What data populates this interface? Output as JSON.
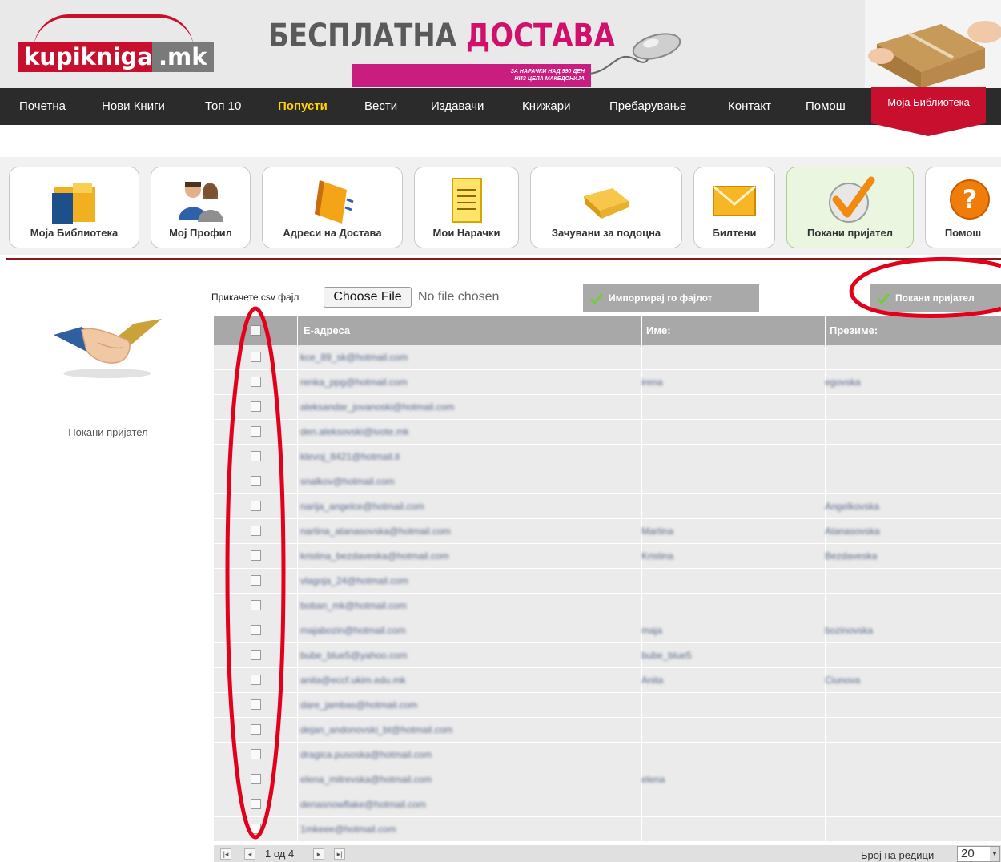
{
  "brand": {
    "logo_left": "kupikniga",
    "logo_right": ".mk"
  },
  "promo": {
    "title_part1": "БЕСПЛАТНА ",
    "title_part2": "ДОСТАВА",
    "subtitle_line1": "ЗА НАРАЧКИ НАД 990 ДЕН",
    "subtitle_line2": "НИЗ ЦЕЛА МАКЕДОНИЈА"
  },
  "nav": {
    "items": [
      "Почетна",
      "Нови Книги",
      "Топ 10",
      "Попусти",
      "Вести",
      "Издавачи",
      "Книжари",
      "Пребарување",
      "Контакт",
      "Помош"
    ],
    "active": "Попусти",
    "library": "Моја Библиотека"
  },
  "tabs": [
    {
      "label": "Моја Библиотека",
      "icon": "folder-icon"
    },
    {
      "label": "Мој Профил",
      "icon": "users-icon"
    },
    {
      "label": "Адреси на Достава",
      "icon": "address-book-icon"
    },
    {
      "label": "Мои Нарачки",
      "icon": "document-icon"
    },
    {
      "label": "Зачувани за подоцна",
      "icon": "open-folder-icon"
    },
    {
      "label": "Билтени",
      "icon": "envelope-icon"
    },
    {
      "label": "Покани пријател",
      "icon": "checkmark-icon",
      "active": true
    },
    {
      "label": "Помош",
      "icon": "help-icon"
    }
  ],
  "sidebar": {
    "caption": "Покани пријател",
    "icon": "handshake-icon"
  },
  "upload": {
    "label": "Прикачете csv фајл",
    "choose_button": "Choose File",
    "no_file": "No file chosen",
    "import_button": "Импортирај го фајлот"
  },
  "invite_button": "Покани пријател",
  "grid": {
    "columns": [
      "Е-адреса",
      "Име:",
      "Презиме:"
    ],
    "rows": [
      {
        "email": "kce_89_sk@hotmail.com",
        "first": "",
        "last": ""
      },
      {
        "email": "renka_ppg@hotmail.com",
        "first": "irena",
        "last": "egovska"
      },
      {
        "email": "aleksandar_jovanoski@hotmail.com",
        "first": "",
        "last": ""
      },
      {
        "email": "den.aleksovski@ivote.mk",
        "first": "",
        "last": ""
      },
      {
        "email": "klevoj_8421@hotmail.it",
        "first": "",
        "last": ""
      },
      {
        "email": "snalkov@hotmail.com",
        "first": "",
        "last": ""
      },
      {
        "email": "narija_angelce@hotmail.com",
        "first": "",
        "last": "Angelkovska"
      },
      {
        "email": "nartina_atanasovska@hotmail.com",
        "first": "Martina",
        "last": "Atanasovska"
      },
      {
        "email": "kristina_bezdaveska@hotmail.com",
        "first": "Kristina",
        "last": "Bezdaveska"
      },
      {
        "email": "vlagoja_24@hotmail.com",
        "first": "",
        "last": ""
      },
      {
        "email": "boban_mk@hotmail.com",
        "first": "",
        "last": ""
      },
      {
        "email": "majabozin@hotmail.com",
        "first": "maja",
        "last": "bozinovska"
      },
      {
        "email": "bube_blue5@yahoo.com",
        "first": "bube_blue5",
        "last": ""
      },
      {
        "email": "anita@eccf.ukim.edu.mk",
        "first": "Anita",
        "last": "Ciunova"
      },
      {
        "email": "dare_jambas@hotmail.com",
        "first": "",
        "last": ""
      },
      {
        "email": "dejan_andonovski_bt@hotmail.com",
        "first": "",
        "last": ""
      },
      {
        "email": "dragica.pusoska@hotmail.com",
        "first": "",
        "last": ""
      },
      {
        "email": "elena_mitrevska@hotmail.com",
        "first": "elena",
        "last": ""
      },
      {
        "email": "denasnowflake@hotmail.com",
        "first": "",
        "last": ""
      },
      {
        "email": "1mkeee@hotmail.com",
        "first": "",
        "last": ""
      }
    ]
  },
  "pager": {
    "info": "1 од 4",
    "rows_label": "Број на редици",
    "rows_value": "20"
  },
  "colors": {
    "brand_red": "#c8102e",
    "nav_bg": "#2b2b2b",
    "nav_active": "#ffd200",
    "annotation": "#e3001b",
    "promo_pink": "#d0106b"
  }
}
